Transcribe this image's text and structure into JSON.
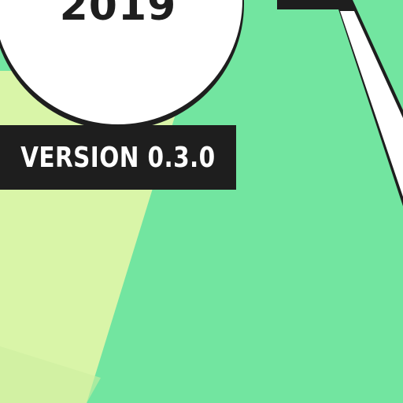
{
  "year": "2019",
  "version_label": "VERSION 0.3.0",
  "colors": {
    "background": "#72e5a0",
    "light_stripe": "#d9f5a8",
    "circle_fill": "#ffffff",
    "dark": "#1e1e1e",
    "badge_text": "#ffffff"
  }
}
